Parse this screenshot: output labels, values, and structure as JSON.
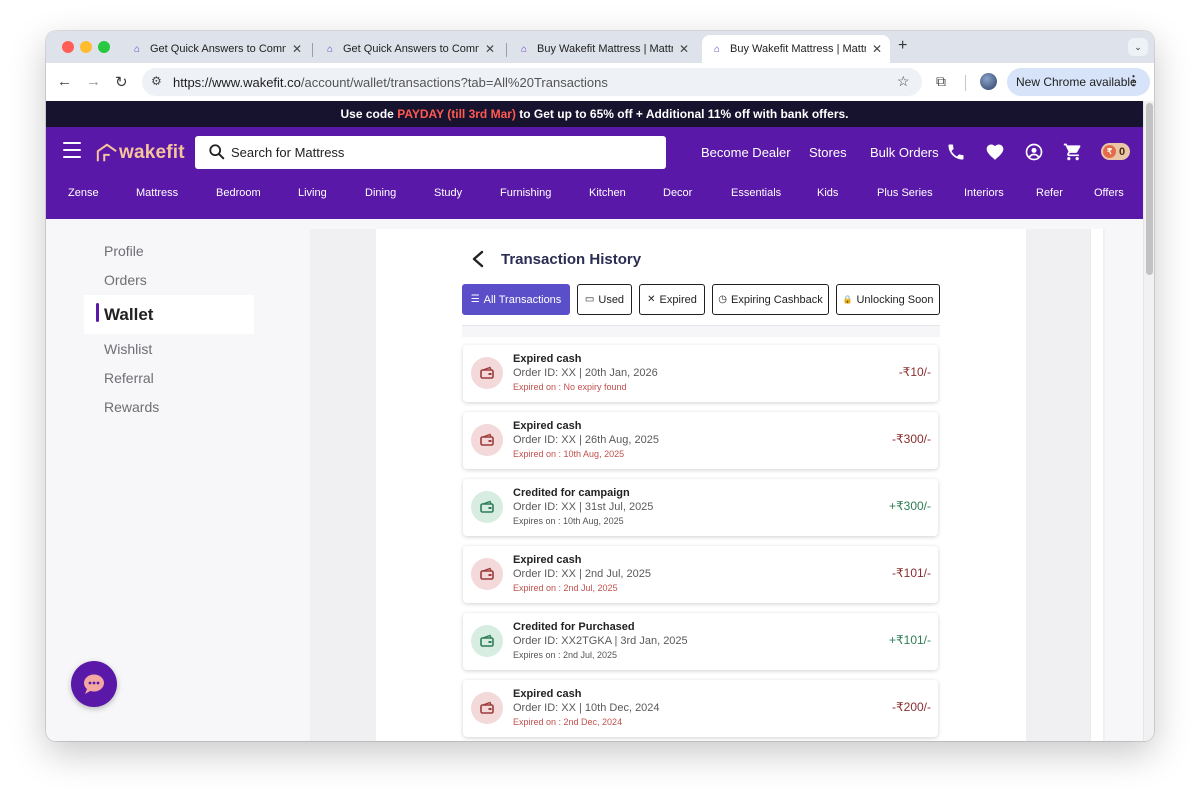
{
  "browser": {
    "tabs": [
      {
        "title": "Get Quick Answers to Common"
      },
      {
        "title": "Get Quick Answers to Common"
      },
      {
        "title": "Buy Wakefit Mattress | Mattress"
      },
      {
        "title": "Buy Wakefit Mattress | Mattress",
        "active": true
      }
    ],
    "url_host": "https://www.wakefit.co",
    "url_path": "/account/wallet/transactions?tab=All%20Transactions",
    "update_label": "New Chrome available"
  },
  "promo": {
    "prefix": "Use code ",
    "code": "PAYDAY (till 3rd Mar)",
    "suffix": " to Get up to 65% off + Additional 11% off with bank offers."
  },
  "header": {
    "logo_text": "wakefit",
    "search_placeholder": "Search for Mattress",
    "links": [
      "Become Dealer",
      "Stores",
      "Bulk Orders"
    ],
    "coin_symbol": "₹",
    "coin_count": "0"
  },
  "categories": [
    "Zense",
    "Mattress",
    "Bedroom",
    "Living",
    "Dining",
    "Study",
    "Furnishing",
    "Kitchen",
    "Decor",
    "Essentials",
    "Kids",
    "Plus Series",
    "Interiors",
    "Refer",
    "Offers"
  ],
  "account_menu": {
    "items": [
      "Profile",
      "Orders",
      "Wallet",
      "Wishlist",
      "Referral",
      "Rewards"
    ],
    "active": "Wallet"
  },
  "wallet": {
    "title": "Transaction History",
    "filters": [
      {
        "label": "All Transactions",
        "icon": "list-icon",
        "glyph": "☰",
        "active": true
      },
      {
        "label": "Used",
        "icon": "card-icon",
        "glyph": "▭"
      },
      {
        "label": "Expired",
        "icon": "x-icon",
        "glyph": "✕"
      },
      {
        "label": "Expiring Cashback",
        "icon": "clock-icon",
        "glyph": "◷"
      },
      {
        "label": "Unlocking Soon",
        "icon": "lock-icon",
        "glyph": "🔒"
      }
    ],
    "transactions": [
      {
        "title": "Expired cash",
        "order": "Order ID: XX | 20th Jan, 2026",
        "expiry": "Expired on : No expiry found",
        "amount": "-₹10/-",
        "kind": "debit"
      },
      {
        "title": "Expired cash",
        "order": "Order ID: XX | 26th Aug, 2025",
        "expiry": "Expired on : 10th Aug, 2025",
        "amount": "-₹300/-",
        "kind": "debit"
      },
      {
        "title": "Credited for campaign",
        "order": "Order ID: XX | 31st Jul, 2025",
        "expiry": "Expires on : 10th Aug, 2025",
        "amount": "+₹300/-",
        "kind": "credit"
      },
      {
        "title": "Expired cash",
        "order": "Order ID: XX | 2nd Jul, 2025",
        "expiry": "Expired on : 2nd Jul, 2025",
        "amount": "-₹101/-",
        "kind": "debit"
      },
      {
        "title": "Credited for Purchased",
        "order": "Order ID: XX2TGKA | 3rd Jan, 2025",
        "expiry": "Expires on : 2nd Jul, 2025",
        "amount": "+₹101/-",
        "kind": "credit"
      },
      {
        "title": "Expired cash",
        "order": "Order ID: XX | 10th Dec, 2024",
        "expiry": "Expired on : 2nd Dec, 2024",
        "amount": "-₹200/-",
        "kind": "debit"
      }
    ]
  },
  "colors": {
    "brand_purple": "#5a18a8",
    "promo_bg": "#17122e",
    "promo_highlight": "#ff5a4e",
    "filter_active": "#5a4fc8",
    "debit_text": "#c0504d",
    "credit_text": "#2e7d55"
  }
}
